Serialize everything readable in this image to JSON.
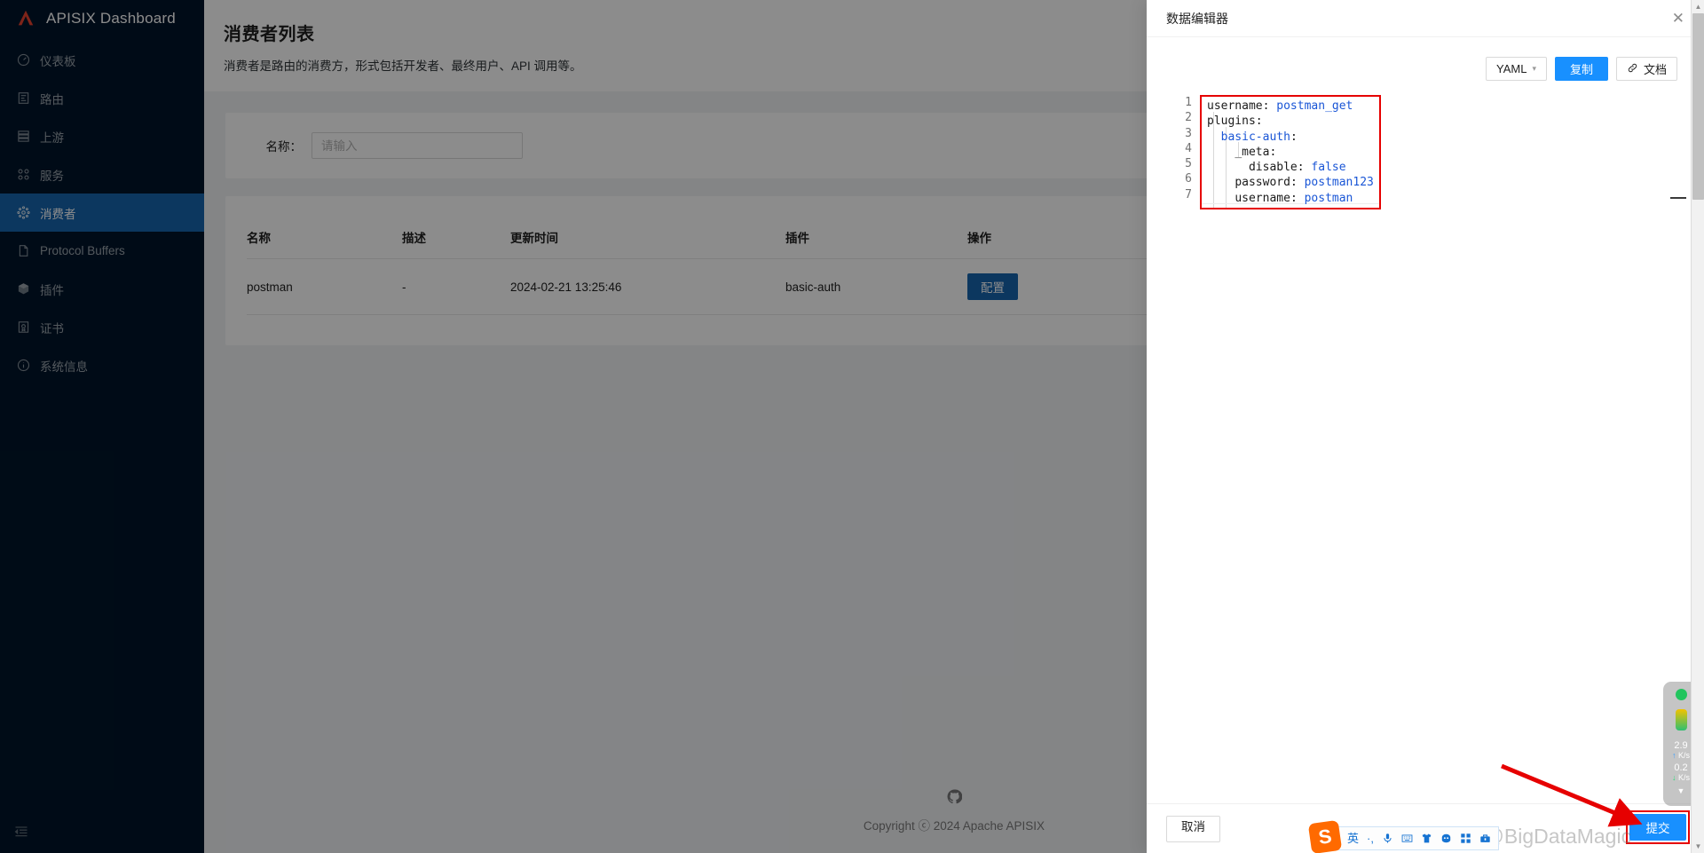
{
  "sidebar": {
    "brand": "APISIX Dashboard",
    "brand_logo_icon": "apisix-logo-icon",
    "collapse_icon": "menu-fold-icon",
    "items": [
      {
        "label": "仪表板",
        "icon": "dashboard-icon",
        "active": false
      },
      {
        "label": "路由",
        "icon": "route-icon",
        "active": false
      },
      {
        "label": "上游",
        "icon": "upstream-icon",
        "active": false
      },
      {
        "label": "服务",
        "icon": "service-icon",
        "active": false
      },
      {
        "label": "消费者",
        "icon": "consumer-icon",
        "active": true
      },
      {
        "label": "Protocol Buffers",
        "icon": "file-icon",
        "active": false
      },
      {
        "label": "插件",
        "icon": "plugin-cube-icon",
        "active": false
      },
      {
        "label": "证书",
        "icon": "certificate-icon",
        "active": false
      },
      {
        "label": "系统信息",
        "icon": "info-circle-icon",
        "active": false
      }
    ]
  },
  "page": {
    "title": "消费者列表",
    "description": "消费者是路由的消费方，形式包括开发者、最终用户、API 调用等。"
  },
  "search": {
    "name_label": "名称：",
    "name_value": "",
    "name_placeholder": "请输入"
  },
  "table": {
    "columns": [
      "名称",
      "描述",
      "更新时间",
      "插件",
      "操作"
    ],
    "rows": [
      {
        "name": "postman",
        "desc": "-",
        "updated": "2024-02-21 13:25:46",
        "plugins": "basic-auth",
        "action_label": "配置"
      }
    ]
  },
  "footer": {
    "github_icon": "github-icon",
    "copyright": "Copyright ⓒ 2024 Apache APISIX"
  },
  "drawer": {
    "title": "数据编辑器",
    "close_icon": "close-icon",
    "toolbar": {
      "format_value": "YAML",
      "format_caret_icon": "chevron-down-icon",
      "copy_label": "复制",
      "doc_label": "文档",
      "doc_icon": "link-icon"
    },
    "editor": {
      "language": "yaml",
      "line_numbers": [
        "1",
        "2",
        "3",
        "4",
        "5",
        "6",
        "7"
      ],
      "lines": [
        [
          {
            "t": "username",
            "c": "key"
          },
          {
            "t": ": ",
            "c": "punct"
          },
          {
            "t": "postman_get",
            "c": "val"
          }
        ],
        [
          {
            "t": "plugins",
            "c": "key"
          },
          {
            "t": ":",
            "c": "punct"
          }
        ],
        [
          {
            "t": "  ",
            "c": "punct"
          },
          {
            "t": "basic-auth",
            "c": "val"
          },
          {
            "t": ":",
            "c": "punct"
          }
        ],
        [
          {
            "t": "    ",
            "c": "punct"
          },
          {
            "t": "_meta",
            "c": "key"
          },
          {
            "t": ":",
            "c": "punct"
          }
        ],
        [
          {
            "t": "      ",
            "c": "punct"
          },
          {
            "t": "disable",
            "c": "key"
          },
          {
            "t": ": ",
            "c": "punct"
          },
          {
            "t": "false",
            "c": "val"
          }
        ],
        [
          {
            "t": "    ",
            "c": "punct"
          },
          {
            "t": "password",
            "c": "key"
          },
          {
            "t": ": ",
            "c": "punct"
          },
          {
            "t": "postman123",
            "c": "val"
          }
        ],
        [
          {
            "t": "    ",
            "c": "punct"
          },
          {
            "t": "username",
            "c": "key"
          },
          {
            "t": ": ",
            "c": "punct"
          },
          {
            "t": "postman",
            "c": "val"
          }
        ]
      ],
      "raw_text": "username: postman_get\nplugins:\n  basic-auth:\n    _meta:\n      disable: false\n    password: postman123\n    username: postman"
    },
    "footer": {
      "cancel_label": "取消",
      "submit_label": "提交"
    }
  },
  "annotations": {
    "arrow_color": "#e60000",
    "highlight_color": "#e60000",
    "watermark": "CSDN @BigDataMagic"
  },
  "ime": {
    "logo_letter": "S",
    "items": [
      {
        "label": "英",
        "icon": "lang-en-icon"
      },
      {
        "label": "·,",
        "icon": "punctuation-icon"
      },
      {
        "label": "",
        "icon": "microphone-icon"
      },
      {
        "label": "",
        "icon": "keyboard-icon"
      },
      {
        "label": "",
        "icon": "skin-icon"
      },
      {
        "label": "",
        "icon": "emoji-icon"
      },
      {
        "label": "",
        "icon": "apps-grid-icon"
      },
      {
        "label": "",
        "icon": "toolbox-icon"
      }
    ]
  },
  "netmeter": {
    "status_icon": "status-dot-icon",
    "upload_value": "2.9",
    "upload_unit": "K/s",
    "upload_icon": "arrow-up-icon",
    "download_value": "0.2",
    "download_unit": "K/s",
    "download_icon": "arrow-down-icon",
    "expand_icon": "caret-down-icon"
  },
  "colors": {
    "sidebar_bg": "#00152a",
    "sidebar_active": "#1765ad",
    "primary": "#1890ff",
    "button_dark_blue": "#1765ad",
    "yaml_value": "#1a56d6",
    "annotation_red": "#e60000"
  }
}
